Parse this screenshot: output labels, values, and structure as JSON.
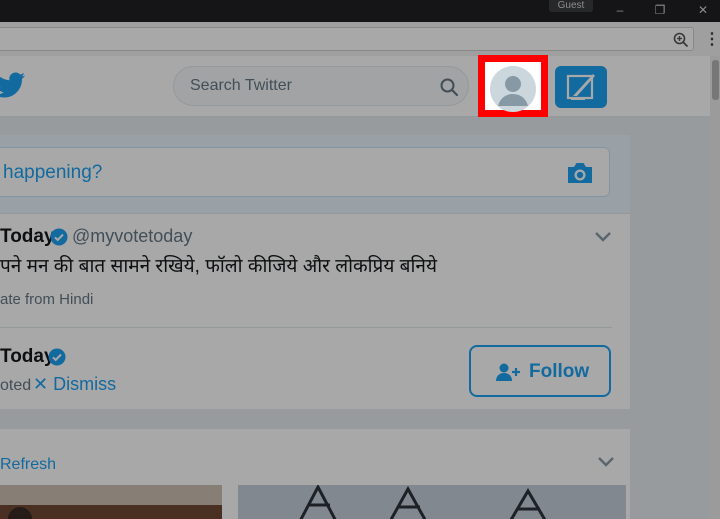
{
  "browser": {
    "profile_label": "Guest",
    "window_controls": {
      "minimize": "–",
      "restore": "❐",
      "close": "✕"
    },
    "icons": {
      "zoom": "zoom-in-icon",
      "menu": "more-vert-icon"
    }
  },
  "twitter": {
    "search": {
      "placeholder": "Search Twitter"
    },
    "compose": {
      "prompt": "happening?"
    },
    "tweet": {
      "name": "Today",
      "handle": "@myvotetoday",
      "text": "पने मन की बात सामने रखिये, फॉलो कीजिये और लोकप्रिय बनिये",
      "translate": "ate from Hindi"
    },
    "promoted_account": {
      "name": "Today",
      "promoted": "oted",
      "dismiss": "✕ Dismiss",
      "follow": "Follow"
    },
    "refresh": "Refresh"
  },
  "colors": {
    "brand": "#1da1f2",
    "highlight": "#ff0000",
    "text_primary": "#14171a",
    "text_secondary": "#657786"
  }
}
